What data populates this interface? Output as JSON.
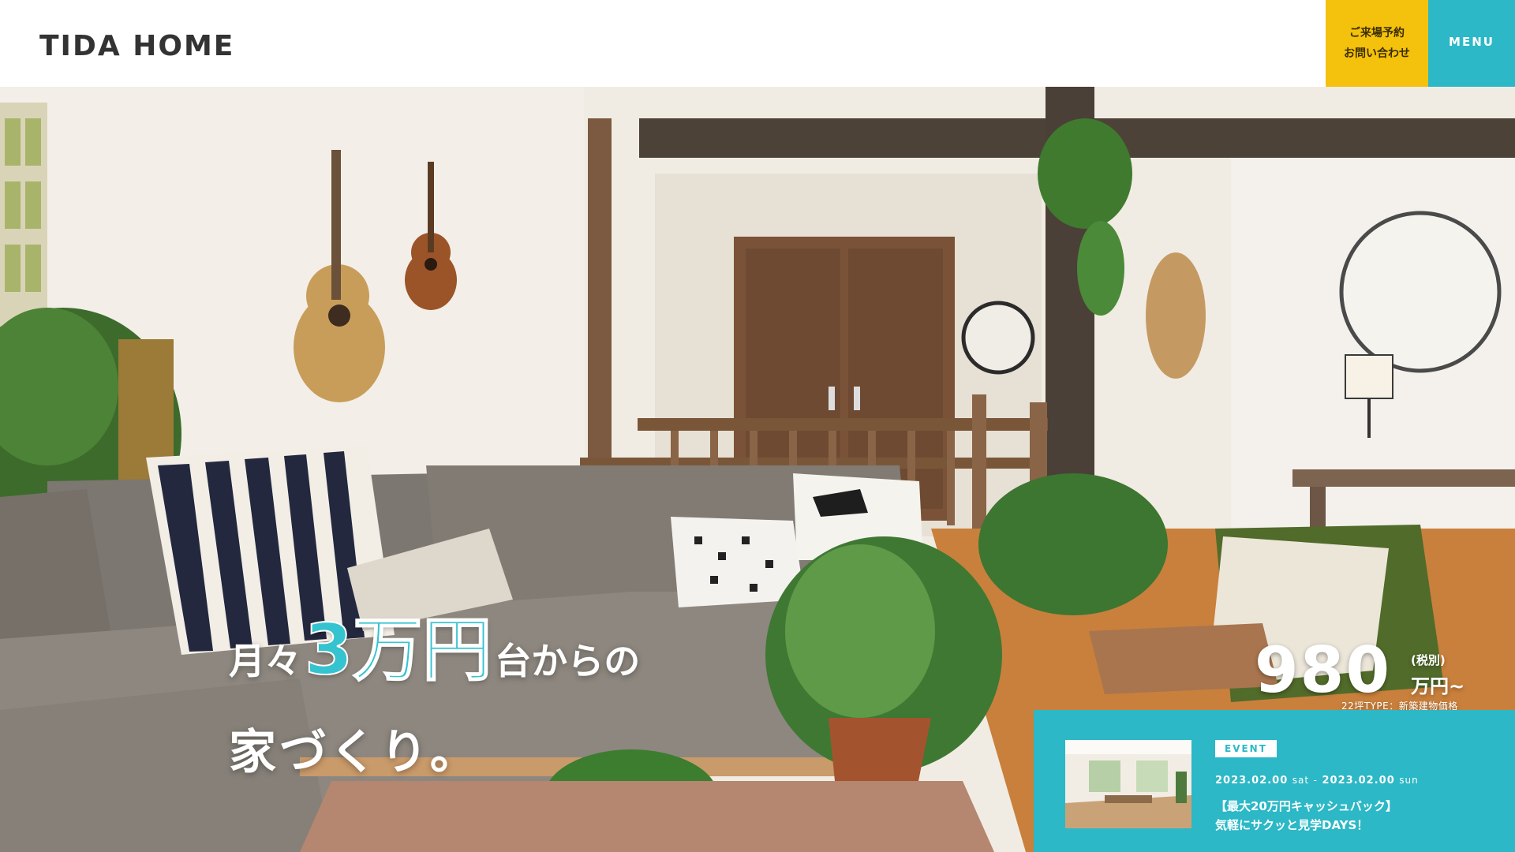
{
  "header": {
    "logo": "TIDA HOME",
    "contact_line1": "ご来場予約",
    "contact_line2": "お問い合わせ",
    "menu_label": "MENU"
  },
  "hero": {
    "copy_prefix": "月々",
    "copy_accent": "3万円",
    "copy_suffix": "台からの",
    "copy_line2": "家づくり。"
  },
  "price": {
    "amount": "980",
    "tax_note": "(税別)",
    "unit": "万円~",
    "type_note": "22坪TYPE：新築建物価格"
  },
  "event": {
    "tag": "EVENT",
    "date_start": "2023.02.00",
    "day_start": "sat",
    "separator": "-",
    "date_end": "2023.02.00",
    "day_end": "sun",
    "title_line1": "【最大20万円キャッシュバック】",
    "title_line2": "気軽にサクッと見学DAYS！"
  },
  "colors": {
    "accent_yellow": "#f4c10c",
    "accent_teal": "#2cb8c6"
  }
}
